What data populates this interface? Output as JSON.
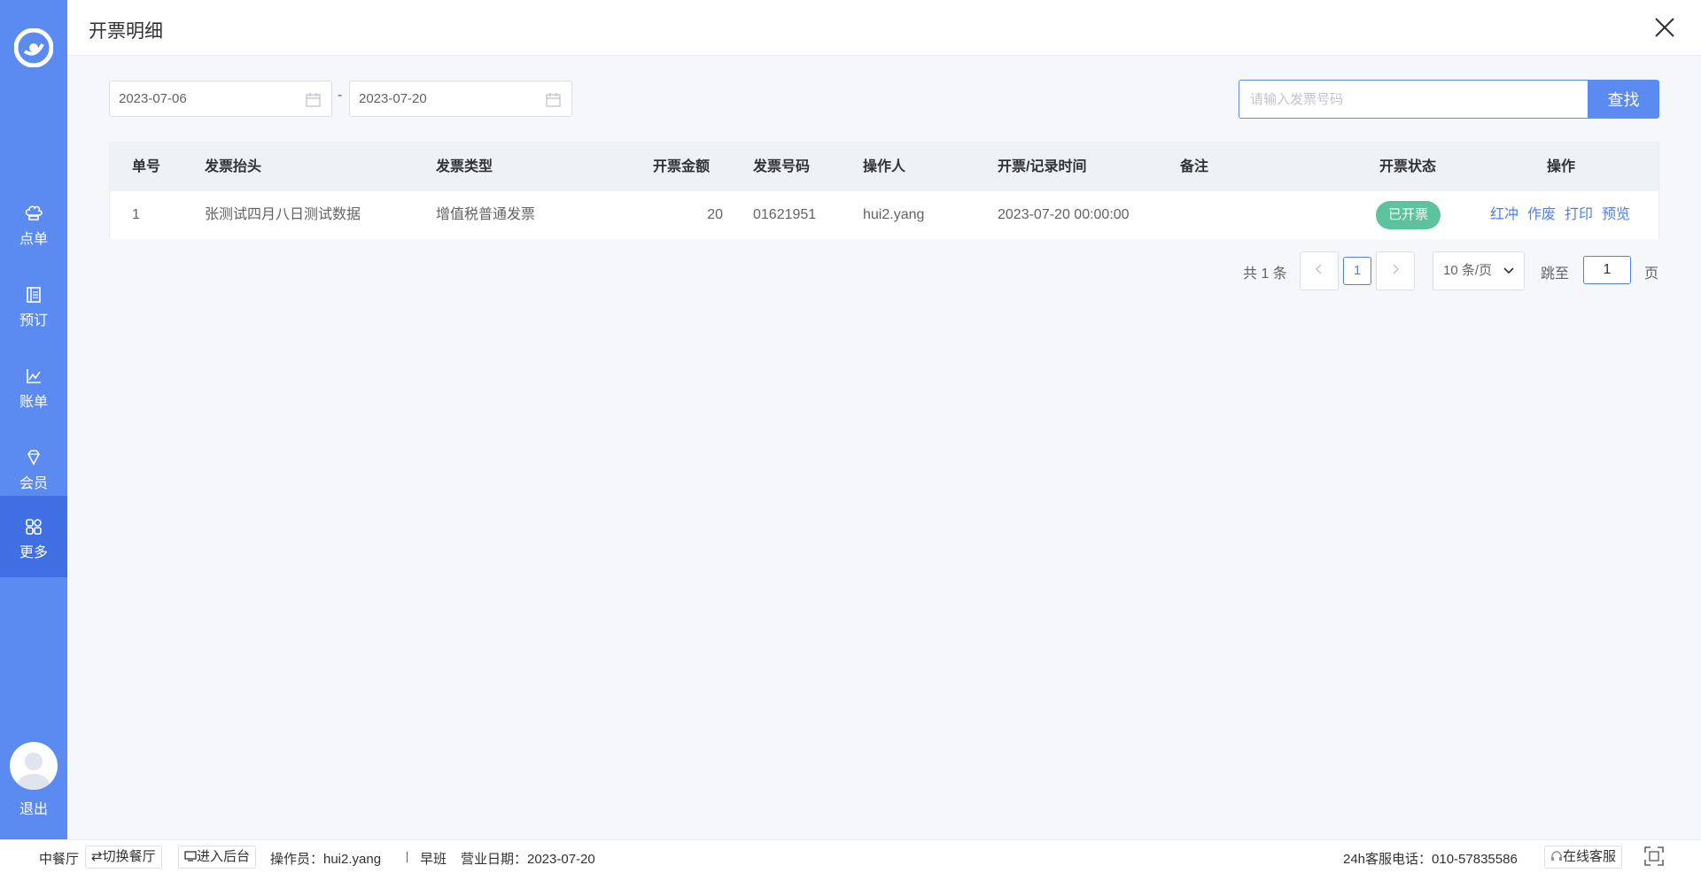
{
  "sidebar": {
    "items": [
      {
        "label": "点单",
        "icon": "chef-hat-icon"
      },
      {
        "label": "预订",
        "icon": "book-icon"
      },
      {
        "label": "账单",
        "icon": "chart-icon"
      },
      {
        "label": "会员",
        "icon": "diamond-icon"
      },
      {
        "label": "更多",
        "icon": "grid-icon"
      }
    ],
    "active_index": 4,
    "logout_label": "退出"
  },
  "header": {
    "title": "开票明细"
  },
  "filters": {
    "start_date": "2023-07-06",
    "end_date": "2023-07-20",
    "separator": "-",
    "search_placeholder": "请输入发票号码",
    "search_button": "查找"
  },
  "table": {
    "columns": [
      "单号",
      "发票抬头",
      "发票类型",
      "开票金额",
      "发票号码",
      "操作人",
      "开票/记录时间",
      "备注",
      "开票状态",
      "操作"
    ],
    "rows": [
      {
        "no": "1",
        "title": "张测试四月八日测试数据",
        "type": "增值税普通发票",
        "amount": "20",
        "invoice_no": "01621951",
        "operator": "hui2.yang",
        "time": "2023-07-20 00:00:00",
        "remark": "",
        "status": "已开票",
        "actions": [
          "红冲",
          "作废",
          "打印",
          "预览"
        ]
      }
    ]
  },
  "pagination": {
    "total_text": "共 1 条",
    "current_page": "1",
    "page_size": "10 条/页",
    "jump_label": "跳至",
    "jump_value": "1",
    "page_label": "页"
  },
  "footer": {
    "restaurant": "中餐厅",
    "switch_restaurant": "⇄切换餐厅",
    "enter_backend": "进入后台",
    "operator": "操作员：hui2.yang",
    "shift": "早班",
    "business_date": "营业日期：2023-07-20",
    "hotline": "24h客服电话：010-57835586",
    "online_service": "在线客服"
  },
  "colors": {
    "sidebar": "#5b8af0",
    "sidebar_active": "#3f6fe3",
    "primary": "#4e7ef0",
    "status_green": "#5cc39c"
  }
}
